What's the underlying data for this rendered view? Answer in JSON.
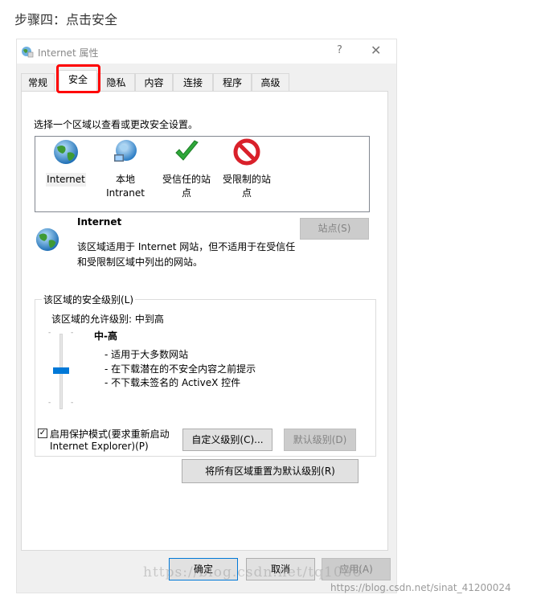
{
  "page_heading": "步骤四：点击安全",
  "window": {
    "title": "Internet 属性",
    "help": "?",
    "close": "✕"
  },
  "tabs": [
    {
      "label": "常规"
    },
    {
      "label": "安全",
      "active": true
    },
    {
      "label": "隐私"
    },
    {
      "label": "内容"
    },
    {
      "label": "连接"
    },
    {
      "label": "程序"
    },
    {
      "label": "高级"
    }
  ],
  "security": {
    "instruction": "选择一个区域以查看或更改安全设置。",
    "zones": [
      {
        "line1": "Internet",
        "line2": "",
        "icon": "globe-icon",
        "selected": true
      },
      {
        "line1": "本地",
        "line2": "Intranet",
        "icon": "network-globe-icon"
      },
      {
        "line1": "受信任的站",
        "line2": "点",
        "icon": "green-check-icon"
      },
      {
        "line1": "受限制的站",
        "line2": "点",
        "icon": "red-no-icon"
      }
    ],
    "selected_zone_name": "Internet",
    "selected_zone_desc_1": "该区域适用于 Internet 网站，但不适用于在受信任",
    "selected_zone_desc_2": "和受限制区域中列出的网站。",
    "sites_button": "站点(S)",
    "level_group_title": "该区域的安全级别(L)",
    "allowed_levels": "该区域的允许级别: 中到高",
    "level_name": "中-高",
    "level_bullets": [
      "- 适用于大多数网站",
      "- 在下载潜在的不安全内容之前提示",
      "- 不下载未签名的 ActiveX 控件"
    ],
    "slider_level": "中-高",
    "protected_mode_checked": true,
    "protected_mode_line1": "启用保护模式(要求重新启动",
    "protected_mode_line2": "Internet Explorer)(P)",
    "custom_level_button": "自定义级别(C)...",
    "default_level_button": "默认级别(D)",
    "reset_all_button": "将所有区域重置为默认级别(R)"
  },
  "footer": {
    "ok": "确定",
    "cancel": "取消",
    "apply": "应用(A)"
  },
  "watermarks": {
    "center": "https://blog.csdn.net/tq1086",
    "corner": "https://blog.csdn.net/sinat_41200024"
  },
  "colors": {
    "highlight_box": "#ff0000",
    "slider_thumb": "#0078d7"
  }
}
